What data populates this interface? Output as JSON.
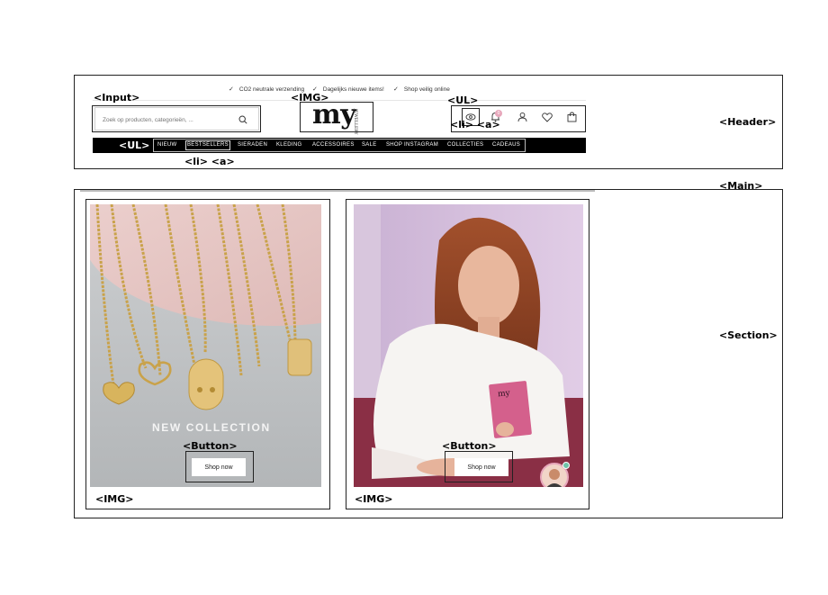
{
  "annotations": {
    "input": "<Input>",
    "img_logo": "<IMG>",
    "ul_icons": "<UL>",
    "li_a_icon": "<li> <a>",
    "header": "<Header>",
    "ul_nav": "<UL>",
    "li_a_nav": "<li> <a>",
    "main": "<Main>",
    "section": "<Section>",
    "button_left": "<Button>",
    "button_right": "<Button>",
    "img_left": "<IMG>",
    "img_right": "<IMG>"
  },
  "usps": [
    {
      "text": "CO2 neutrale verzending"
    },
    {
      "text": "Dagelijks nieuwe items!"
    },
    {
      "text": "Shop veilig online"
    }
  ],
  "search": {
    "placeholder": "Zoek op producten, categorieën, ..."
  },
  "logo": {
    "text": "my",
    "sub": "JEWELLERY"
  },
  "header_icons": {
    "notification_count": "0",
    "icons": [
      "eye-icon",
      "bell-icon",
      "user-icon",
      "heart-icon",
      "bag-icon"
    ]
  },
  "nav": {
    "items": [
      "NIEUW",
      "BESTSELLERS",
      "SIERADEN",
      "KLEDING",
      "ACCESSOIRES",
      "SALE",
      "SHOP INSTAGRAM",
      "COLLECTIES",
      "CADEAUS"
    ]
  },
  "cards": [
    {
      "headline": "NEW COLLECTION",
      "button": "Shop now"
    },
    {
      "headline": "",
      "button": "Shop now",
      "card_text": "my make your own luck"
    }
  ],
  "colors": {
    "nav_bg": "#000000",
    "badge": "#e7a7bb",
    "chat_status": "#6fc2a8"
  }
}
